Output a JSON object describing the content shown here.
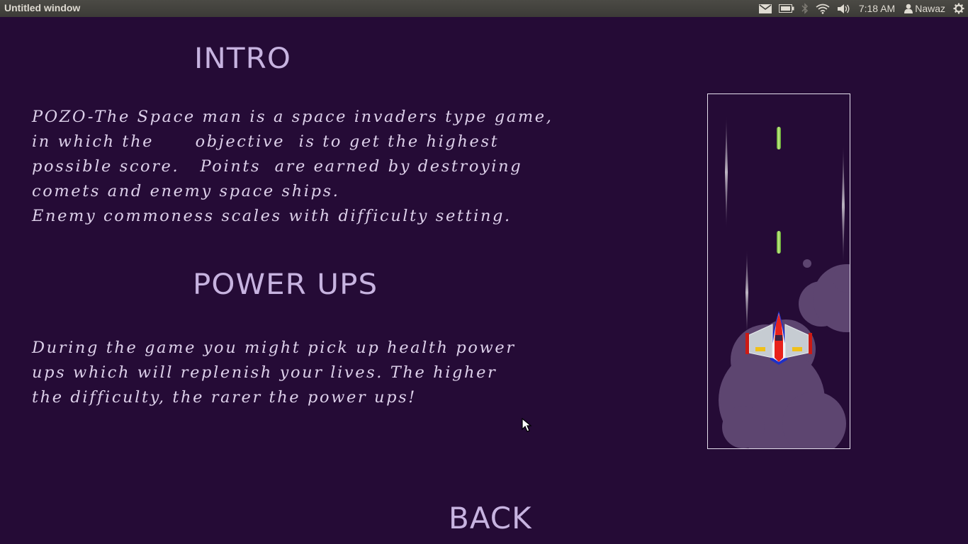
{
  "topbar": {
    "window_title": "Untitled window",
    "clock": "7:18 AM",
    "user_name": "Nawaz",
    "icons": [
      "mail-icon",
      "battery-icon",
      "bluetooth-icon",
      "wifi-icon",
      "volume-icon",
      "user-icon",
      "settings-gear-icon"
    ]
  },
  "intro": {
    "heading": "INTRO",
    "lines": [
      "POZO-The Space man is a space invaders type game,",
      "in which the      objective  is to get the highest",
      "possible score.   Points  are earned by destroying",
      "comets and enemy space ships.",
      "Enemy commoness scales with difficulty setting."
    ]
  },
  "power_ups": {
    "heading": "POWER UPS",
    "lines": [
      "During the game you might pick up health power",
      "ups which will replenish your lives. The higher",
      "the difficulty, the rarer the power ups!"
    ]
  },
  "back_button": {
    "label": "BACK"
  },
  "colors": {
    "background": "#250b36",
    "heading": "#c7b3e0",
    "text": "#ddd0ea",
    "smoke": "#5d4570",
    "laser": "#8ed04b",
    "ship_red": "#e8221c"
  }
}
